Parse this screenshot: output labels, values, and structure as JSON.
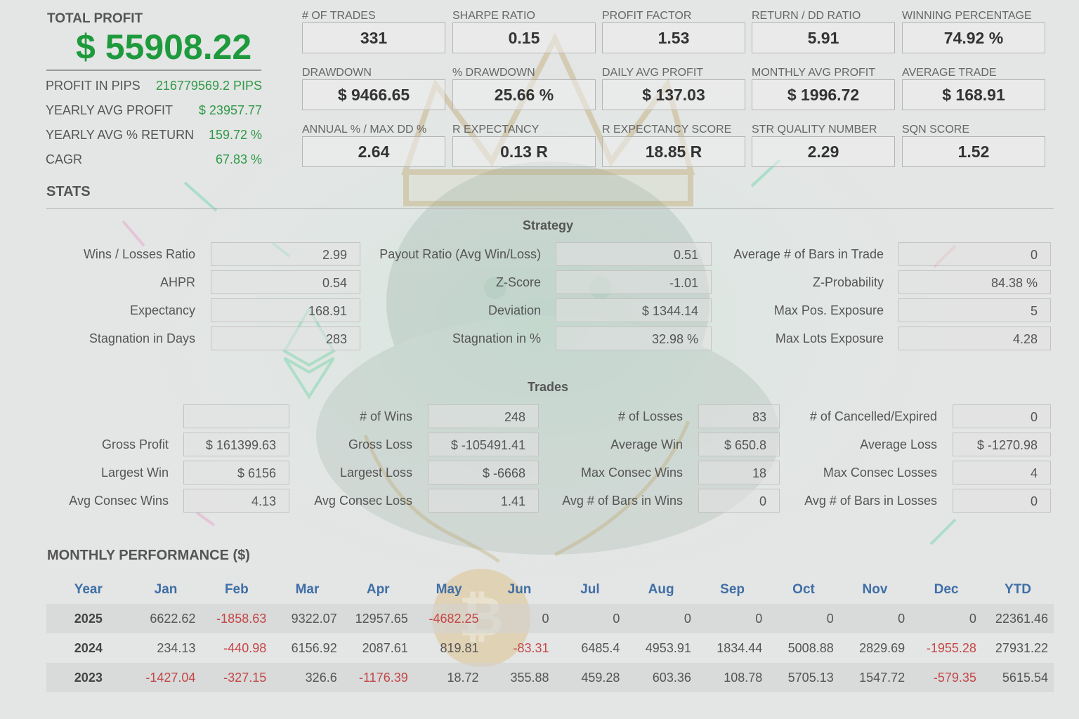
{
  "header": {
    "total_profit_label": "TOTAL PROFIT",
    "total_profit_value": "$ 55908.22",
    "profit_pips_label": "PROFIT IN PIPS",
    "profit_pips_value": "216779569.2 PIPS",
    "yearly_avg_profit_label": "YEARLY AVG PROFIT",
    "yearly_avg_profit_value": "$ 23957.77",
    "yearly_avg_return_label": "YEARLY AVG % RETURN",
    "yearly_avg_return_value": "159.72 %",
    "cagr_label": "CAGR",
    "cagr_value": "67.83 %"
  },
  "kpis": [
    {
      "label": "# OF TRADES",
      "value": "331"
    },
    {
      "label": "SHARPE RATIO",
      "value": "0.15"
    },
    {
      "label": "PROFIT FACTOR",
      "value": "1.53"
    },
    {
      "label": "RETURN / DD RATIO",
      "value": "5.91"
    },
    {
      "label": "WINNING PERCENTAGE",
      "value": "74.92 %"
    },
    {
      "label": "DRAWDOWN",
      "value": "$ 9466.65"
    },
    {
      "label": "% DRAWDOWN",
      "value": "25.66 %"
    },
    {
      "label": "DAILY AVG PROFIT",
      "value": "$ 137.03"
    },
    {
      "label": "MONTHLY AVG PROFIT",
      "value": "$ 1996.72"
    },
    {
      "label": "AVERAGE TRADE",
      "value": "$ 168.91"
    },
    {
      "label": "ANNUAL % / MAX DD %",
      "value": "2.64"
    },
    {
      "label": "R EXPECTANCY",
      "value": "0.13 R"
    },
    {
      "label": "R EXPECTANCY SCORE",
      "value": "18.85 R"
    },
    {
      "label": "STR QUALITY NUMBER",
      "value": "2.29"
    },
    {
      "label": "SQN SCORE",
      "value": "1.52"
    }
  ],
  "stats": {
    "title": "STATS",
    "strategy_title": "Strategy",
    "strategy": [
      {
        "label": "Wins / Losses Ratio",
        "value": "2.99"
      },
      {
        "label": "AHPR",
        "value": "0.54"
      },
      {
        "label": "Expectancy",
        "value": "168.91"
      },
      {
        "label": "Stagnation in Days",
        "value": "283"
      },
      {
        "label": "Payout Ratio (Avg Win/Loss)",
        "value": "0.51"
      },
      {
        "label": "Z-Score",
        "value": "-1.01"
      },
      {
        "label": "Deviation",
        "value": "$ 1344.14"
      },
      {
        "label": "Stagnation in %",
        "value": "32.98 %"
      },
      {
        "label": "Average # of Bars in Trade",
        "value": "0"
      },
      {
        "label": "Z-Probability",
        "value": "84.38 %"
      },
      {
        "label": "Max Pos. Exposure",
        "value": "5"
      },
      {
        "label": "Max Lots Exposure",
        "value": "4.28"
      }
    ],
    "trades_title": "Trades",
    "trades": [
      {
        "label": "",
        "value": ""
      },
      {
        "label": "Gross Profit",
        "value": "$ 161399.63"
      },
      {
        "label": "Largest Win",
        "value": "$ 6156"
      },
      {
        "label": "Avg Consec Wins",
        "value": "4.13"
      },
      {
        "label": "# of Wins",
        "value": "248"
      },
      {
        "label": "Gross Loss",
        "value": "$ -105491.41"
      },
      {
        "label": "Largest Loss",
        "value": "$ -6668"
      },
      {
        "label": "Avg Consec Loss",
        "value": "1.41"
      },
      {
        "label": "# of Losses",
        "value": "83"
      },
      {
        "label": "Average Win",
        "value": "$ 650.8"
      },
      {
        "label": "Max Consec Wins",
        "value": "18"
      },
      {
        "label": "Avg # of Bars in Wins",
        "value": "0"
      },
      {
        "label": "# of Cancelled/Expired",
        "value": "0"
      },
      {
        "label": "Average Loss",
        "value": "$ -1270.98"
      },
      {
        "label": "Max Consec Losses",
        "value": "4"
      },
      {
        "label": "Avg # of Bars in Losses",
        "value": "0"
      }
    ]
  },
  "monthly": {
    "title": "MONTHLY PERFORMANCE ($)",
    "headers": [
      "Year",
      "Jan",
      "Feb",
      "Mar",
      "Apr",
      "May",
      "Jun",
      "Jul",
      "Aug",
      "Sep",
      "Oct",
      "Nov",
      "Dec",
      "YTD"
    ],
    "rows": [
      [
        "2025",
        "6622.62",
        "-1858.63",
        "9322.07",
        "12957.65",
        "-4682.25",
        "0",
        "0",
        "0",
        "0",
        "0",
        "0",
        "0",
        "22361.46"
      ],
      [
        "2024",
        "234.13",
        "-440.98",
        "6156.92",
        "2087.61",
        "819.81",
        "-83.31",
        "6485.4",
        "4953.91",
        "1834.44",
        "5008.88",
        "2829.69",
        "-1955.28",
        "27931.22"
      ],
      [
        "2023",
        "-1427.04",
        "-327.15",
        "326.6",
        "-1176.39",
        "18.72",
        "355.88",
        "459.28",
        "603.36",
        "108.78",
        "5705.13",
        "1547.72",
        "-579.35",
        "5615.54"
      ]
    ]
  },
  "colors": {
    "profit_green": "#1e9a3c",
    "header_blue": "#3f6fa6",
    "negative_red": "#c44747"
  },
  "icons": [
    "crown-icon",
    "gorilla-illustration",
    "bitcoin-icon",
    "ethereum-icon"
  ]
}
